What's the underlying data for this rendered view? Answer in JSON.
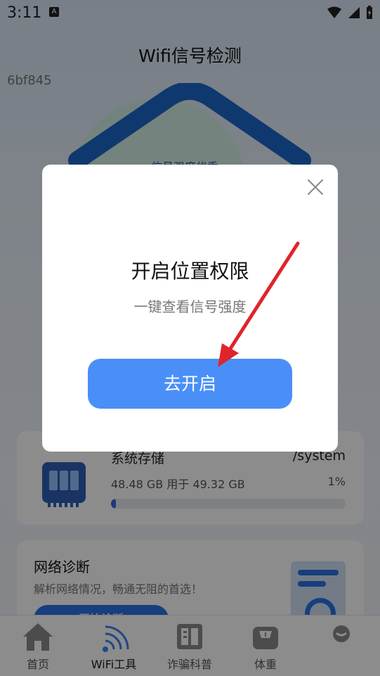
{
  "status_bar": {
    "time": "3:11",
    "notification_icon": "A"
  },
  "header": {
    "title": "Wifi信号检测",
    "hash_text": "6bf845"
  },
  "gauge": {
    "label": "信号强度优秀"
  },
  "storage": {
    "title": "系统存储",
    "path": "/system",
    "usage_text": "48.48 GB 用于 49.32 GB",
    "percent_text": "1%",
    "percent_value": 0.01
  },
  "network": {
    "title": "网络诊断",
    "description": "解析网络情况，畅通无阻的首选！",
    "button_label": "开始诊断"
  },
  "tabs": [
    {
      "label": "首页",
      "icon": "home-icon"
    },
    {
      "label": "WiFi工具",
      "icon": "wifi-icon"
    },
    {
      "label": "诈骗科普",
      "icon": "book-icon"
    },
    {
      "label": "体重",
      "icon": "scale-icon"
    },
    {
      "label": "",
      "icon": "profile-icon"
    }
  ],
  "dialog": {
    "title": "开启位置权限",
    "subtitle": "一键查看信号强度",
    "button_label": "去开启"
  },
  "colors": {
    "accent": "#4a8ff7",
    "arrow": "#e0242b",
    "overlay": "rgba(0,0,0,0.45)"
  }
}
